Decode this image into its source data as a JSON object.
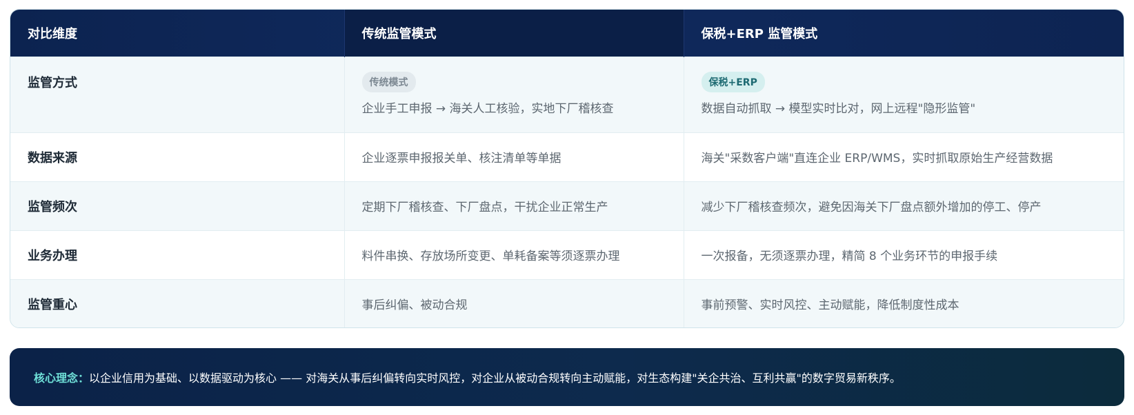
{
  "table": {
    "headers": [
      "对比维度",
      "传统监管模式",
      "保税+ERP 监管模式"
    ],
    "rows": [
      {
        "dimension": "监管方式",
        "traditional_tag": "传统模式",
        "traditional": "企业手工申报 → 海关人工核验，实地下厂稽核查",
        "erp_tag": "保税+ERP",
        "erp": "数据自动抓取 → 模型实时比对，网上远程\"隐形监管\""
      },
      {
        "dimension": "数据来源",
        "traditional": "企业逐票申报报关单、核注清单等单据",
        "erp": "海关\"采数客户端\"直连企业 ERP/WMS，实时抓取原始生产经营数据"
      },
      {
        "dimension": "监管频次",
        "traditional": "定期下厂稽核查、下厂盘点，干扰企业正常生产",
        "erp": "减少下厂稽核查频次，避免因海关下厂盘点额外增加的停工、停产"
      },
      {
        "dimension": "业务办理",
        "traditional": "料件串换、存放场所变更、单耗备案等须逐票办理",
        "erp": "一次报备，无须逐票办理，精简 8 个业务环节的申报手续"
      },
      {
        "dimension": "监管重心",
        "traditional": "事后纠偏、被动合规",
        "erp": "事前预警、实时风控、主动赋能，降低制度性成本"
      }
    ]
  },
  "core": {
    "label": "核心理念：",
    "text": "以企业信用为基础、以数据驱动为核心 —— 对海关从事后纠偏转向实时风控，对企业从被动合规转向主动赋能，对生态构建\"关企共治、互利共赢\"的数字贸易新秩序。"
  },
  "colors": {
    "header_bg": "#0c2350",
    "accent_teal": "#6fe0d8",
    "row_alt_bg": "#f2f8fa"
  }
}
